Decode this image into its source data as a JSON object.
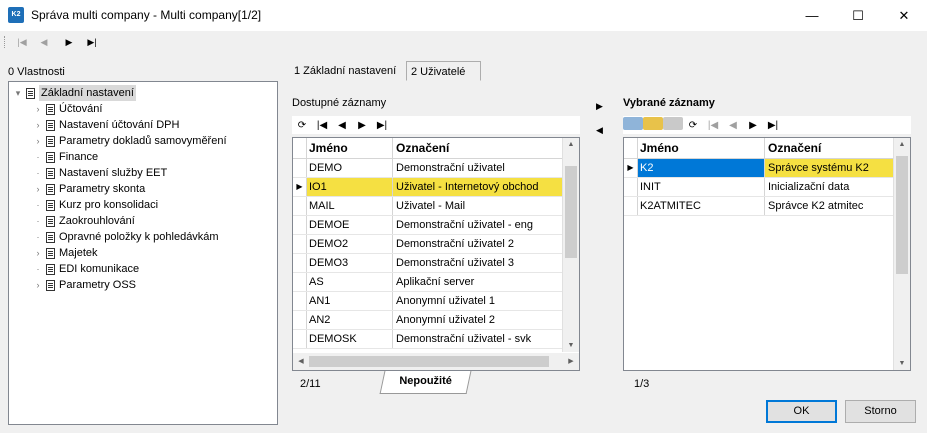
{
  "window": {
    "icon_text": "K2",
    "title": "Správa multi company - Multi company[1/2]",
    "minimize_label": "—",
    "maximize_label": "☐",
    "close_label": "✕"
  },
  "toolbar": {
    "first_label": "|◀",
    "prev_label": "◀",
    "next_label": "▶",
    "last_label": "▶|"
  },
  "properties": {
    "label": "0 Vlastnosti",
    "root": "Základní nastavení",
    "items": [
      {
        "label": "Účtování",
        "expandable": true
      },
      {
        "label": "Nastavení účtování DPH",
        "expandable": true
      },
      {
        "label": "Parametry dokladů samovyměření",
        "expandable": true
      },
      {
        "label": "Finance",
        "expandable": false
      },
      {
        "label": "Nastavení služby EET",
        "expandable": false
      },
      {
        "label": "Parametry skonta",
        "expandable": true
      },
      {
        "label": "Kurz pro konsolidaci",
        "expandable": false
      },
      {
        "label": "Zaokrouhlování",
        "expandable": false
      },
      {
        "label": "Opravné položky k pohledávkám",
        "expandable": false
      },
      {
        "label": "Majetek",
        "expandable": true
      },
      {
        "label": "EDI komunikace",
        "expandable": false
      },
      {
        "label": "Parametry OSS",
        "expandable": true
      }
    ]
  },
  "tabs": [
    {
      "label": "1 Základní nastavení"
    },
    {
      "label": "2 Uživatelé"
    }
  ],
  "available": {
    "label": "Dostupné záznamy",
    "columns": [
      "Jméno",
      "Označení"
    ],
    "rows": [
      [
        "DEMO",
        "Demonstrační uživatel"
      ],
      [
        "IO1",
        "Uživatel - Internetový obchod"
      ],
      [
        "MAIL",
        "Uživatel - Mail"
      ],
      [
        "DEMOE",
        "Demonstrační uživatel - eng"
      ],
      [
        "DEMO2",
        "Demonstrační uživatel 2"
      ],
      [
        "DEMO3",
        "Demonstrační uživatel 3"
      ],
      [
        "AS",
        "Aplikační server"
      ],
      [
        "AN1",
        "Anonymní uživatel 1"
      ],
      [
        "AN2",
        "Anonymní uživatel 2"
      ],
      [
        "DEMOSK",
        "Demonstrační uživatel - svk"
      ]
    ],
    "counter": "2/11",
    "bottom_tab": "Nepoužité"
  },
  "transfer": {
    "add_label": "▶",
    "remove_label": "◀"
  },
  "selected": {
    "label": "Vybrané záznamy",
    "columns": [
      "Jméno",
      "Označení"
    ],
    "rows": [
      [
        "K2",
        "Správce systému K2"
      ],
      [
        "INIT",
        "Inicializační data"
      ],
      [
        "K2ATMITEC",
        "Správce K2 atmitec"
      ]
    ],
    "counter": "1/3"
  },
  "buttons": {
    "ok": "OK",
    "cancel": "Storno"
  },
  "colors": {
    "highlight": "#f5e042",
    "selection_blue": "#0078d7"
  }
}
